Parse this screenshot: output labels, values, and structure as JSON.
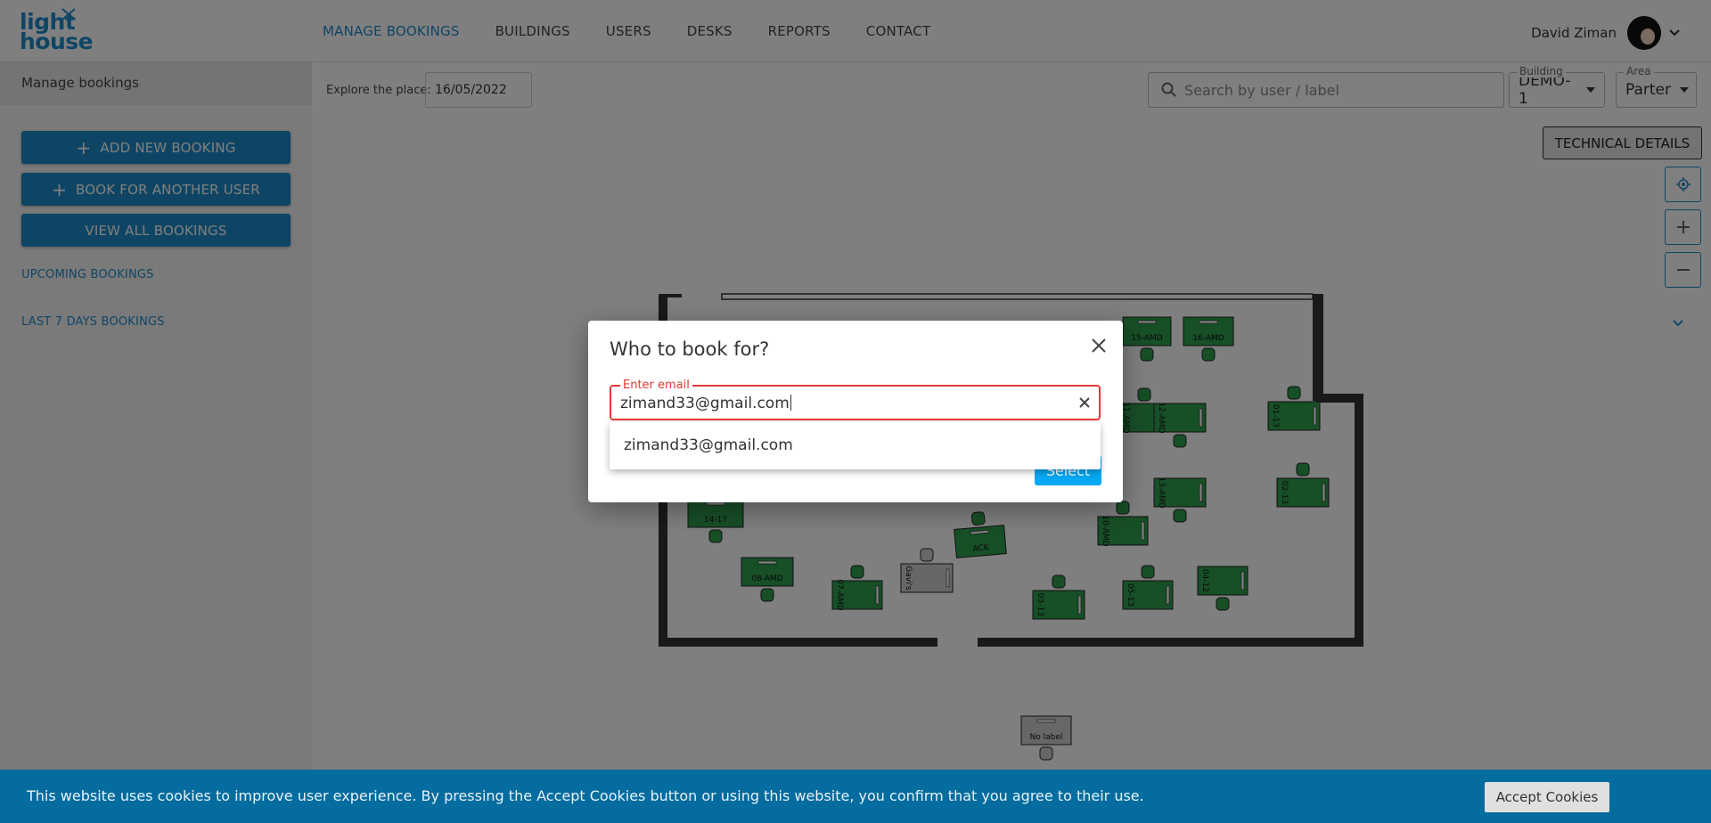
{
  "logo": {
    "line1": "light",
    "line2": "house"
  },
  "nav": {
    "items": [
      {
        "label": "MANAGE BOOKINGS"
      },
      {
        "label": "BUILDINGS"
      },
      {
        "label": "USERS"
      },
      {
        "label": "DESKS"
      },
      {
        "label": "REPORTS"
      },
      {
        "label": "CONTACT"
      }
    ],
    "active": "MANAGE BOOKINGS"
  },
  "user": {
    "name": "David Ziman"
  },
  "sidebar": {
    "title": "Manage bookings",
    "add_new_booking": "ADD NEW BOOKING",
    "book_for_another": "BOOK FOR ANOTHER USER",
    "view_all": "VIEW ALL BOOKINGS",
    "upcoming": "UPCOMING BOOKINGS",
    "last7": "LAST 7 DAYS BOOKINGS"
  },
  "toolbar": {
    "explore_label": "Explore the place:",
    "date_value": "16/05/2022",
    "search_placeholder": "Search by user / label",
    "building_label": "Building",
    "building_value": "DEMO-1",
    "area_label": "Area",
    "area_value": "Parter",
    "technical_details": "TECHNICAL DETAILS"
  },
  "floorplan": {
    "desks": [
      {
        "label": "15-AMD"
      },
      {
        "label": "16-AMD"
      },
      {
        "label": "11-AMD"
      },
      {
        "label": "12-AMD"
      },
      {
        "label": "01-13"
      },
      {
        "label": "13-AMD"
      },
      {
        "label": "02-13"
      },
      {
        "label": "10-AMD"
      },
      {
        "label": "08-AMD"
      },
      {
        "label": "07-AMD"
      },
      {
        "label": "Gavi's"
      },
      {
        "label": "14-17"
      },
      {
        "label": "03-13"
      },
      {
        "label": "05-13"
      },
      {
        "label": "04-12"
      },
      {
        "label": "ACK"
      },
      {
        "label": "No label"
      }
    ]
  },
  "dialog": {
    "title": "Who to book for?",
    "email_legend": "Enter email",
    "email_value": "zimand33@gmail.com",
    "suggestion": "zimand33@gmail.com",
    "select_label": "Select"
  },
  "cookie": {
    "text": "This website uses cookies to improve user experience. By pressing the Accept Cookies button or using this website, you confirm that you agree to their use.",
    "accept": "Accept Cookies"
  },
  "colors": {
    "brand": "#1f8bc9",
    "desk_green": "#2e9e4f",
    "error_red": "#e53935",
    "cookie_bar": "#046c9e"
  }
}
